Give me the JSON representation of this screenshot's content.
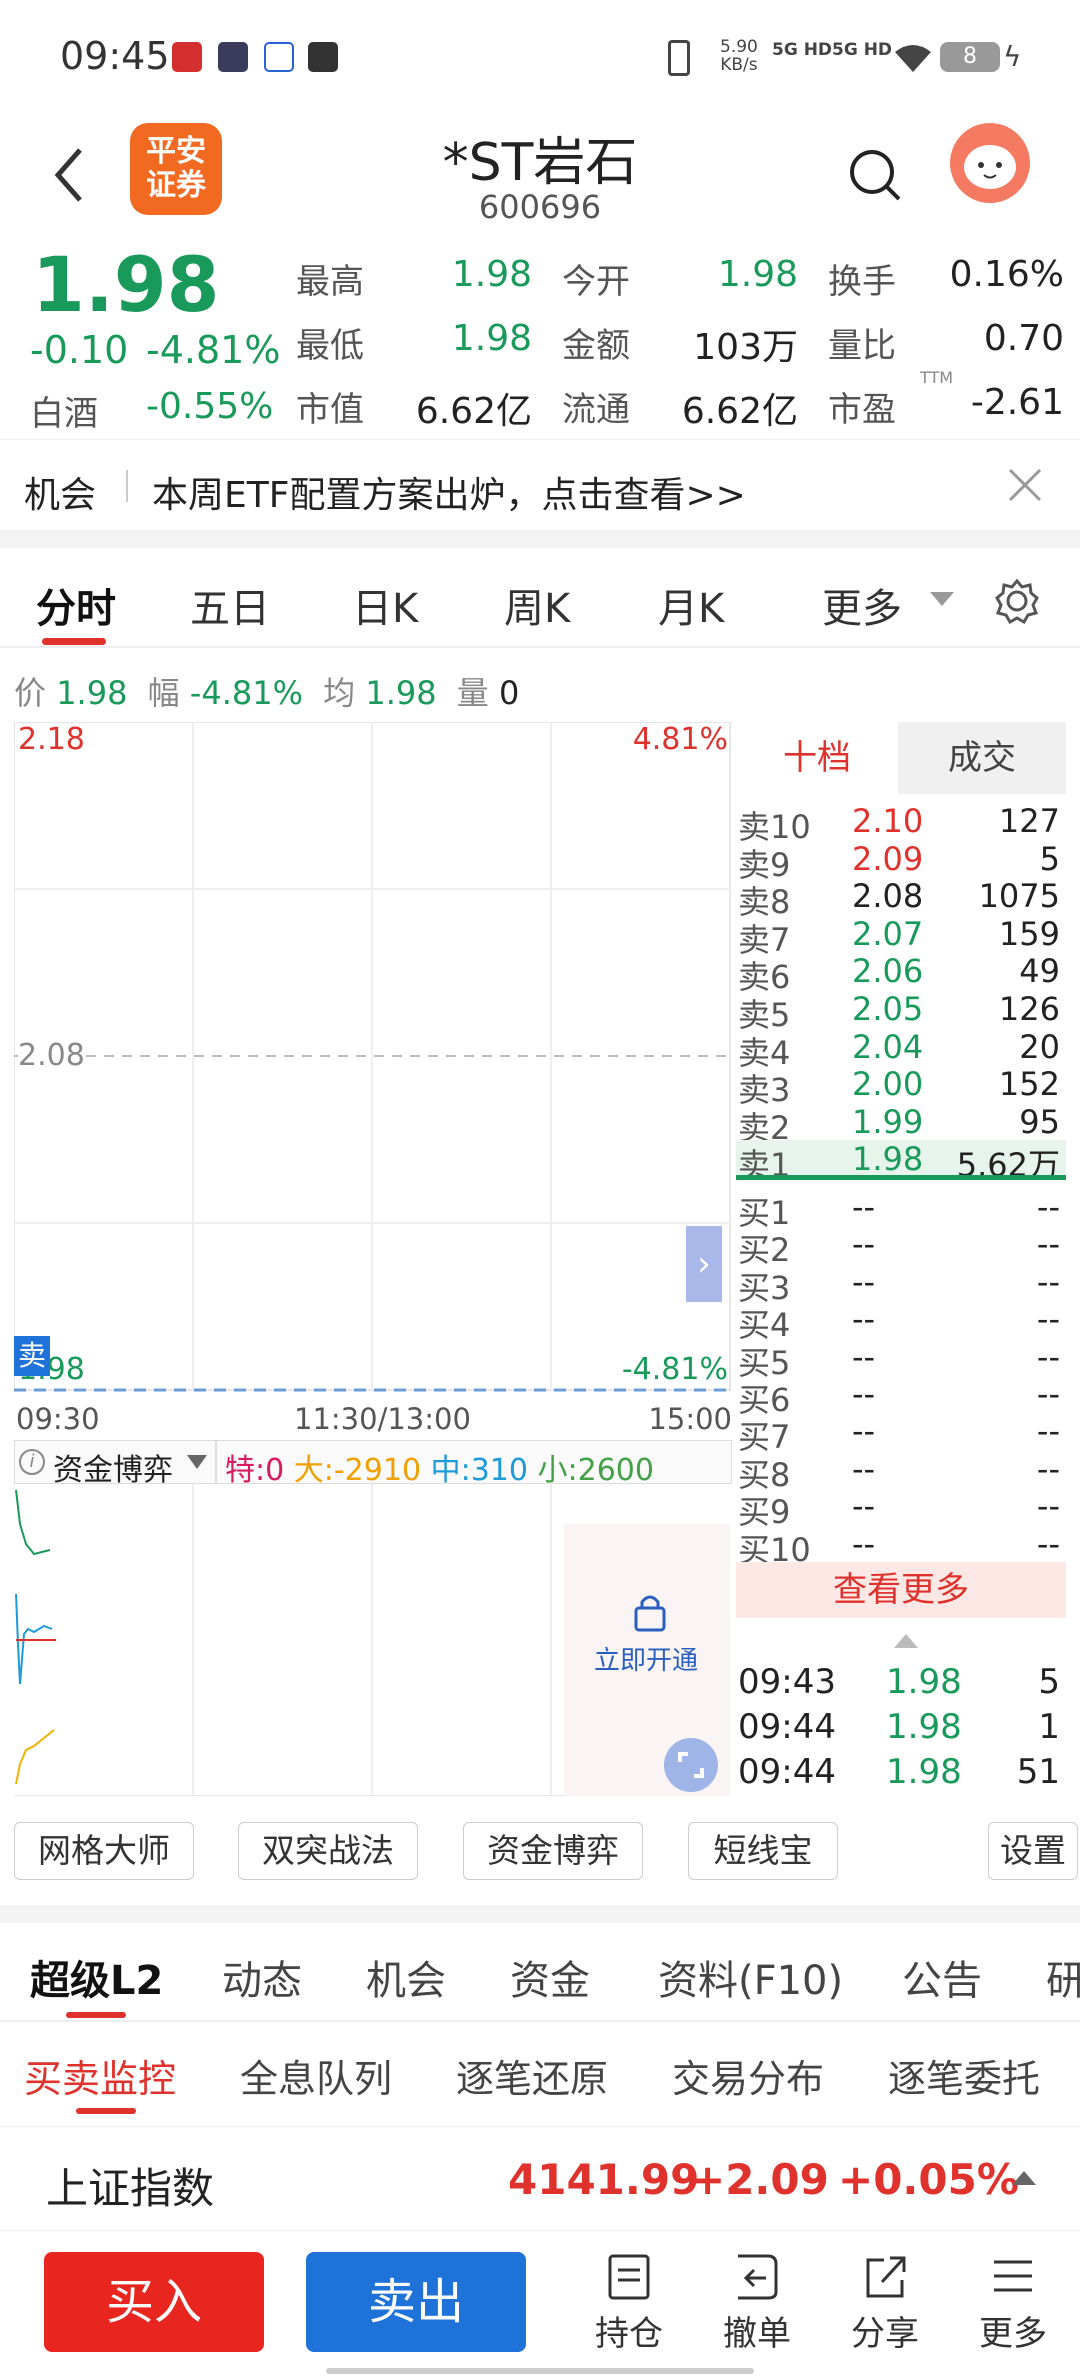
{
  "status": {
    "time": "09:45",
    "net_speed": "5.90",
    "net_unit": "KB/s",
    "sig1": "5G HD",
    "sig2": "5G HD",
    "battery": "8"
  },
  "header": {
    "logo_text": "平安\n证券",
    "logo_line1": "平安",
    "logo_line2": "证券",
    "title": "*ST岩石",
    "code": "600696"
  },
  "quote": {
    "price": "1.98",
    "change": "-0.10",
    "change_pct": "-4.81%",
    "sector_name": "白酒",
    "sector_pct": "-0.55%",
    "rows": [
      [
        {
          "l": "最高",
          "v": "1.98",
          "c": "green"
        },
        {
          "l": "今开",
          "v": "1.98",
          "c": "green"
        },
        {
          "l": "换手",
          "v": "0.16%",
          "c": "dark"
        }
      ],
      [
        {
          "l": "最低",
          "v": "1.98",
          "c": "green"
        },
        {
          "l": "金额",
          "v": "103万",
          "c": "dark"
        },
        {
          "l": "量比",
          "v": "0.70",
          "c": "dark"
        }
      ],
      [
        {
          "l": "市值",
          "v": "6.62亿",
          "c": "dark"
        },
        {
          "l": "流通",
          "v": "6.62亿",
          "c": "dark"
        },
        {
          "l": "市盈",
          "v": "-2.61",
          "c": "dark",
          "sup": "TTM"
        }
      ]
    ]
  },
  "promo": {
    "label": "机会",
    "text": "本周ETF配置方案出炉，点击查看>>"
  },
  "chart_tabs": [
    "分时",
    "五日",
    "日K",
    "周K",
    "月K",
    "更多"
  ],
  "info": {
    "price_label": "价",
    "price": "1.98",
    "amp_label": "幅",
    "amp": "-4.81%",
    "avg_label": "均",
    "avg": "1.98",
    "vol_label": "量",
    "vol": "0"
  },
  "chart": {
    "y_top": "2.18",
    "y_mid": "2.08",
    "y_bot": "1.98",
    "pct_top": "4.81%",
    "pct_bot": "-4.81%",
    "x_labels": [
      "09:30",
      "11:30/13:00",
      "15:00"
    ],
    "sell_tag": "卖"
  },
  "flow": {
    "title": "资金博弈",
    "special_label": "特:",
    "special": "0",
    "large_label": "大:",
    "large": "-2910",
    "mid_label": "中:",
    "mid": "310",
    "small_label": "小:",
    "small": "2600",
    "unlock": "立即开通"
  },
  "book": {
    "tab_active": "十档",
    "tab_other": "成交",
    "asks": [
      {
        "l": "卖10",
        "p": "2.10",
        "v": "127",
        "c": "red"
      },
      {
        "l": "卖9",
        "p": "2.09",
        "v": "5",
        "c": "red"
      },
      {
        "l": "卖8",
        "p": "2.08",
        "v": "1075",
        "c": "dark"
      },
      {
        "l": "卖7",
        "p": "2.07",
        "v": "159",
        "c": "green"
      },
      {
        "l": "卖6",
        "p": "2.06",
        "v": "49",
        "c": "green"
      },
      {
        "l": "卖5",
        "p": "2.05",
        "v": "126",
        "c": "green"
      },
      {
        "l": "卖4",
        "p": "2.04",
        "v": "20",
        "c": "green"
      },
      {
        "l": "卖3",
        "p": "2.00",
        "v": "152",
        "c": "green"
      },
      {
        "l": "卖2",
        "p": "1.99",
        "v": "95",
        "c": "green"
      },
      {
        "l": "卖1",
        "p": "1.98",
        "v": "5.62万",
        "c": "green"
      }
    ],
    "bids": [
      {
        "l": "买1",
        "p": "--",
        "v": "--"
      },
      {
        "l": "买2",
        "p": "--",
        "v": "--"
      },
      {
        "l": "买3",
        "p": "--",
        "v": "--"
      },
      {
        "l": "买4",
        "p": "--",
        "v": "--"
      },
      {
        "l": "买5",
        "p": "--",
        "v": "--"
      },
      {
        "l": "买6",
        "p": "--",
        "v": "--"
      },
      {
        "l": "买7",
        "p": "--",
        "v": "--"
      },
      {
        "l": "买8",
        "p": "--",
        "v": "--"
      },
      {
        "l": "买9",
        "p": "--",
        "v": "--"
      },
      {
        "l": "买10",
        "p": "--",
        "v": "--"
      }
    ],
    "see_more": "查看更多",
    "trades": [
      {
        "t": "09:43",
        "p": "1.98",
        "v": "5"
      },
      {
        "t": "09:44",
        "p": "1.98",
        "v": "1"
      },
      {
        "t": "09:44",
        "p": "1.98",
        "v": "51"
      }
    ]
  },
  "tools": [
    "网格大师",
    "双突战法",
    "资金博弈",
    "短线宝",
    "设置"
  ],
  "sections": [
    "超级L2",
    "动态",
    "机会",
    "资金",
    "资料(F10)",
    "公告",
    "研"
  ],
  "subsections": [
    "买卖监控",
    "全息队列",
    "逐笔还原",
    "交易分布",
    "逐笔委托"
  ],
  "index": {
    "name": "上证指数",
    "value": "4141.99",
    "change": "+2.09",
    "pct": "+0.05%"
  },
  "bottom": {
    "buy": "买入",
    "sell": "卖出",
    "items": [
      "持仓",
      "撤单",
      "分享",
      "更多"
    ]
  },
  "colors": {
    "red": "#e0322d",
    "green": "#1a9a5a",
    "blue": "#1e72d8"
  }
}
